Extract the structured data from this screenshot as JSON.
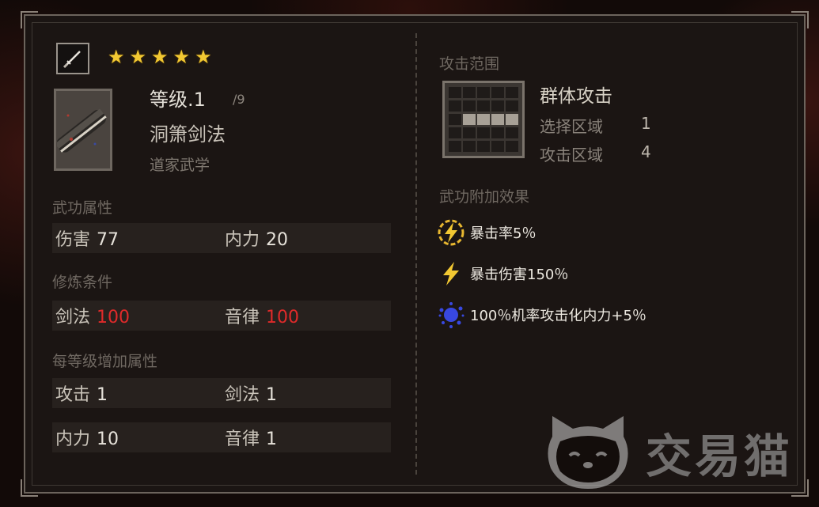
{
  "stars": {
    "count": 5,
    "color": "#f2c832"
  },
  "skill": {
    "level_label": "等级.1",
    "level_max": "/9",
    "name": "洞箫剑法",
    "type": "道家武学",
    "weapon_icon": "sword-icon",
    "item_icon": "scroll-icon"
  },
  "attributes": {
    "title": "武功属性",
    "items": [
      {
        "label": "伤害",
        "value": "77"
      },
      {
        "label": "内力",
        "value": "20"
      }
    ]
  },
  "requirements": {
    "title": "修炼条件",
    "items": [
      {
        "label": "剑法",
        "value": "100"
      },
      {
        "label": "音律",
        "value": "100"
      }
    ],
    "value_color": "#e02a2a"
  },
  "per_level": {
    "title": "每等级增加属性",
    "rows": [
      [
        {
          "label": "攻击",
          "value": "1"
        },
        {
          "label": "剑法",
          "value": "1"
        }
      ],
      [
        {
          "label": "内力",
          "value": "10"
        },
        {
          "label": "音律",
          "value": "1"
        }
      ]
    ]
  },
  "attack_range": {
    "title": "攻击范围",
    "name": "群体攻击",
    "select_label": "选择区域",
    "select_value": "1",
    "attack_label": "攻击区域",
    "attack_value": "4"
  },
  "effects": {
    "title": "武功附加效果",
    "items": [
      {
        "icon": "lightning-circle-icon",
        "text": "暴击率5％"
      },
      {
        "icon": "lightning-icon",
        "text": "暴击伤害150％"
      },
      {
        "icon": "blue-burst-icon",
        "text": "100％机率攻击化内力+5％"
      }
    ]
  },
  "watermark": {
    "text": "交易猫",
    "icon": "cat-face-icon"
  }
}
